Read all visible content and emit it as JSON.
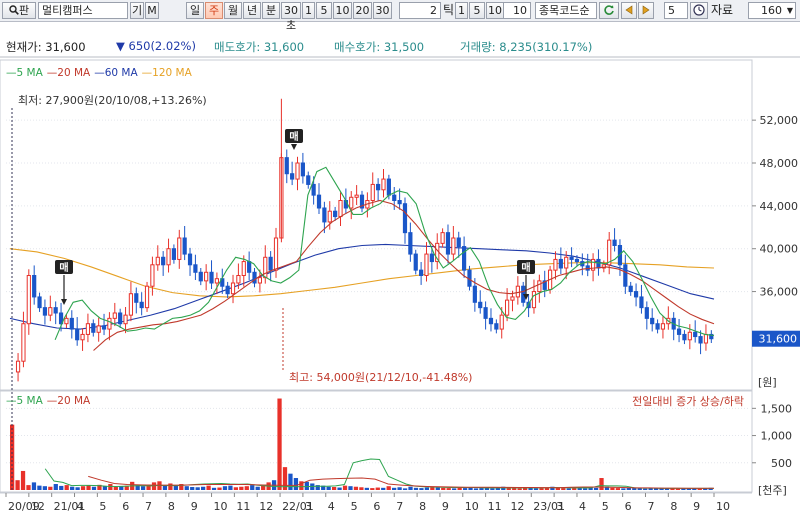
{
  "toolbar": {
    "search_icon": "magnifier-icon",
    "search_btn_label": "판",
    "stock_name": "멀티캠퍼스",
    "btn_gi": "기",
    "btn_m": "M",
    "periods": [
      "일",
      "주",
      "월",
      "년",
      "분",
      "30초",
      "1",
      "5",
      "10",
      "20",
      "30"
    ],
    "active_period": "주",
    "tick_value": "2",
    "tick_label": "틱",
    "tick_btns": [
      "1",
      "5",
      "10"
    ],
    "tick_input": "10",
    "code_label": "종목코드순",
    "count_value": "5",
    "data_label": "자료",
    "data_value": "160"
  },
  "quote": {
    "price_label": "현재가: 31,600",
    "change": "650(2.02%)",
    "ask": "매도호가: 31,600",
    "bid": "매수호가: 31,500",
    "volume": "거래량: 8,235(310.17%)"
  },
  "legend_price": [
    {
      "label": "5 MA",
      "color": "#2ea44f"
    },
    {
      "label": "20 MA",
      "color": "#c0392b"
    },
    {
      "label": "60 MA",
      "color": "#1f3aa8"
    },
    {
      "label": "120 MA",
      "color": "#e6a124"
    }
  ],
  "legend_volume": [
    {
      "label": "5 MA",
      "color": "#2ea44f"
    },
    {
      "label": "20 MA",
      "color": "#c0392b"
    }
  ],
  "annotations": {
    "low": "최저: 27,900원(20/10/08,+13.26%)",
    "high": "최고: 54,000원(21/12/10,-41.48%)",
    "volume_note": "전일대비 증가 상승/하락",
    "current_price": "31,600",
    "price_unit": "[원]",
    "volume_unit": "[천주]",
    "marker_label": "매"
  },
  "colors": {
    "up": "#e8312a",
    "down": "#1a56c8",
    "ma5": "#2ea44f",
    "ma20": "#c0392b",
    "ma60": "#1f3aa8",
    "ma120": "#e6a124",
    "price_box": "#1a56c8"
  },
  "chart_data": {
    "type": "candlestick",
    "period": "weekly",
    "price_axis": {
      "ticks": [
        "52,000",
        "48,000",
        "44,000",
        "40,000",
        "36,000"
      ],
      "range": [
        27000,
        55000
      ]
    },
    "volume_axis": {
      "ticks": [
        "1,500",
        "1,000",
        "500"
      ],
      "range": [
        0,
        1800
      ]
    },
    "x_ticks": [
      "20/09",
      "12",
      "21/01",
      "4",
      "5",
      "6",
      "7",
      "8",
      "9",
      "10",
      "11",
      "12",
      "22/01",
      "3",
      "4",
      "5",
      "6",
      "7",
      "8",
      "9",
      "10",
      "11",
      "12",
      "23/01",
      "3",
      "4",
      "5",
      "6",
      "7",
      "8",
      "9",
      "10"
    ],
    "price_path": [
      28500,
      29500,
      33000,
      37500,
      35500,
      34500,
      33800,
      34500,
      34000,
      33000,
      33500,
      32500,
      31500,
      32000,
      33000,
      32200,
      32800,
      32500,
      33500,
      34000,
      33000,
      33800,
      35800,
      35000,
      34500,
      36500,
      38500,
      39200,
      38500,
      40000,
      39000,
      41000,
      39500,
      38500,
      37800,
      37000,
      37800,
      36800,
      37200,
      36500,
      35800,
      36800,
      37500,
      38800,
      37800,
      36800,
      37300,
      39200,
      38000,
      41000,
      48500,
      47000,
      46500,
      48000,
      46800,
      46000,
      45000,
      43800,
      42500,
      43500,
      43000,
      44500,
      43800,
      44800,
      45000,
      43800,
      44500,
      46000,
      45500,
      46500,
      45000,
      44500,
      44200,
      41500,
      39500,
      38000,
      37500,
      39500,
      38800,
      40500,
      41500,
      39500,
      41000,
      40200,
      38000,
      36500,
      35000,
      34500,
      33500,
      33000,
      32500,
      33800,
      35200,
      35500,
      36500,
      35000,
      34500,
      36000,
      37000,
      36200,
      38000,
      39000,
      38200,
      39200,
      39000,
      38800,
      38400,
      38000,
      39000,
      38200,
      38500,
      40800,
      40300,
      38500,
      36500,
      36000,
      35500,
      34500,
      33500,
      33000,
      32500,
      33000,
      33500,
      32500,
      32000,
      31500,
      32200,
      31800,
      31200,
      32000,
      31600
    ],
    "ma5_values": [
      null,
      null,
      null,
      null,
      null,
      31500,
      33500,
      35000,
      35200,
      34200,
      33500,
      33200,
      32800,
      32300,
      32400,
      32600,
      32500,
      33000,
      33500,
      33600,
      33800,
      34200,
      35000,
      36500,
      38000,
      39200,
      39000,
      38600,
      37500,
      37000,
      36800,
      37300,
      38000,
      45000,
      47200,
      47600,
      46200,
      44800,
      43200,
      43200,
      43800,
      44200,
      45000,
      45400,
      45200,
      44200,
      41500,
      39500,
      38200,
      38800,
      39500,
      40100,
      38800,
      36500,
      34800,
      33600,
      33400,
      34200,
      35600,
      36000,
      36200,
      36800,
      37800,
      38500,
      38800,
      38700,
      38600,
      39000,
      39800,
      38800,
      37200,
      35500,
      34000,
      33200,
      32800,
      32600,
      32300,
      32000,
      31900
    ],
    "ma20_values": [
      null,
      null,
      null,
      null,
      null,
      null,
      null,
      30500,
      31500,
      32200,
      32500,
      32700,
      32900,
      33000,
      33200,
      33500,
      33800,
      34400,
      35100,
      35900,
      36700,
      37500,
      38000,
      38400,
      38800,
      40200,
      41500,
      42500,
      43200,
      43800,
      44200,
      44500,
      44200,
      43500,
      42300,
      40900,
      39600,
      38500,
      37500,
      36800,
      36200,
      35900,
      35800,
      36000,
      36500,
      37000,
      37500,
      37800,
      38100,
      38200,
      38300,
      38100,
      37600,
      37000,
      36200,
      35400,
      34600,
      33900,
      33400,
      33000
    ],
    "ma60_values": [
      33500,
      33000,
      32600,
      32500,
      32800,
      33300,
      33800,
      34400,
      35200,
      36000,
      36800,
      37700,
      38600,
      39400,
      40000,
      40300,
      40400,
      40300,
      40200,
      40100,
      40000,
      39900,
      39800,
      39600,
      39300,
      38800,
      38200,
      37400,
      36600,
      35800,
      35300
    ],
    "ma120_values": [
      40000,
      39700,
      39100,
      38300,
      37400,
      36500,
      35900,
      35600,
      35500,
      35600,
      35800,
      36100,
      36400,
      36800,
      37200,
      37500,
      37800,
      38100,
      38300,
      38500,
      38600,
      38700,
      38700,
      38600,
      38500,
      38300,
      38200
    ],
    "volume_values": [
      1200,
      180,
      350,
      90,
      140,
      80,
      70,
      60,
      110,
      75,
      90,
      60,
      50,
      70,
      85,
      60,
      95,
      70,
      110,
      55,
      65,
      80,
      150,
      90,
      70,
      100,
      140,
      160,
      90,
      120,
      80,
      110,
      70,
      55,
      50,
      60,
      80,
      40,
      45,
      70,
      80,
      50,
      60,
      70,
      90,
      60,
      75,
      140,
      180,
      1680,
      420,
      300,
      220,
      160,
      150,
      120,
      90,
      80,
      60,
      55,
      45,
      80,
      70,
      60,
      50,
      40,
      35,
      45,
      40,
      70,
      40,
      50,
      30,
      60,
      40,
      35,
      45,
      50,
      45,
      40,
      35,
      30,
      40,
      35,
      45,
      30,
      35,
      40,
      30,
      45,
      60,
      40,
      35,
      30,
      55,
      40,
      30,
      35,
      45,
      60,
      40,
      35,
      30,
      40,
      35,
      30,
      45,
      40,
      220,
      60,
      40,
      35,
      30,
      40,
      35,
      30,
      25,
      35,
      30,
      40,
      35,
      30,
      25,
      30,
      35,
      30,
      25,
      30,
      40
    ],
    "vol_ma5_values": [
      null,
      null,
      null,
      null,
      390,
      165,
      140,
      80,
      85,
      85,
      80,
      70,
      65,
      70,
      75,
      80,
      75,
      85,
      80,
      80,
      90,
      100,
      110,
      115,
      120,
      110,
      105,
      110,
      90,
      75,
      65,
      60,
      65,
      60,
      65,
      70,
      70,
      75,
      100,
      500,
      540,
      570,
      560,
      250,
      180,
      110,
      70,
      60,
      55,
      50,
      45,
      45,
      45,
      45,
      40,
      40,
      40,
      40,
      40,
      40,
      40,
      42,
      45,
      42,
      40,
      40,
      40,
      80,
      75,
      75,
      70,
      40,
      35,
      35,
      30,
      30,
      30,
      30,
      30,
      30,
      30
    ],
    "vol_ma20_values": [
      null,
      null,
      null,
      null,
      null,
      null,
      250,
      180,
      120,
      100,
      95,
      90,
      90,
      90,
      95,
      100,
      100,
      100,
      100,
      95,
      90,
      85,
      85,
      180,
      200,
      210,
      215,
      220,
      200,
      110,
      90,
      75,
      65,
      60,
      55,
      50,
      50,
      50,
      48,
      46,
      45,
      44,
      42,
      50,
      55,
      55,
      50,
      45,
      40,
      38,
      35,
      34,
      33,
      32,
      32
    ]
  }
}
